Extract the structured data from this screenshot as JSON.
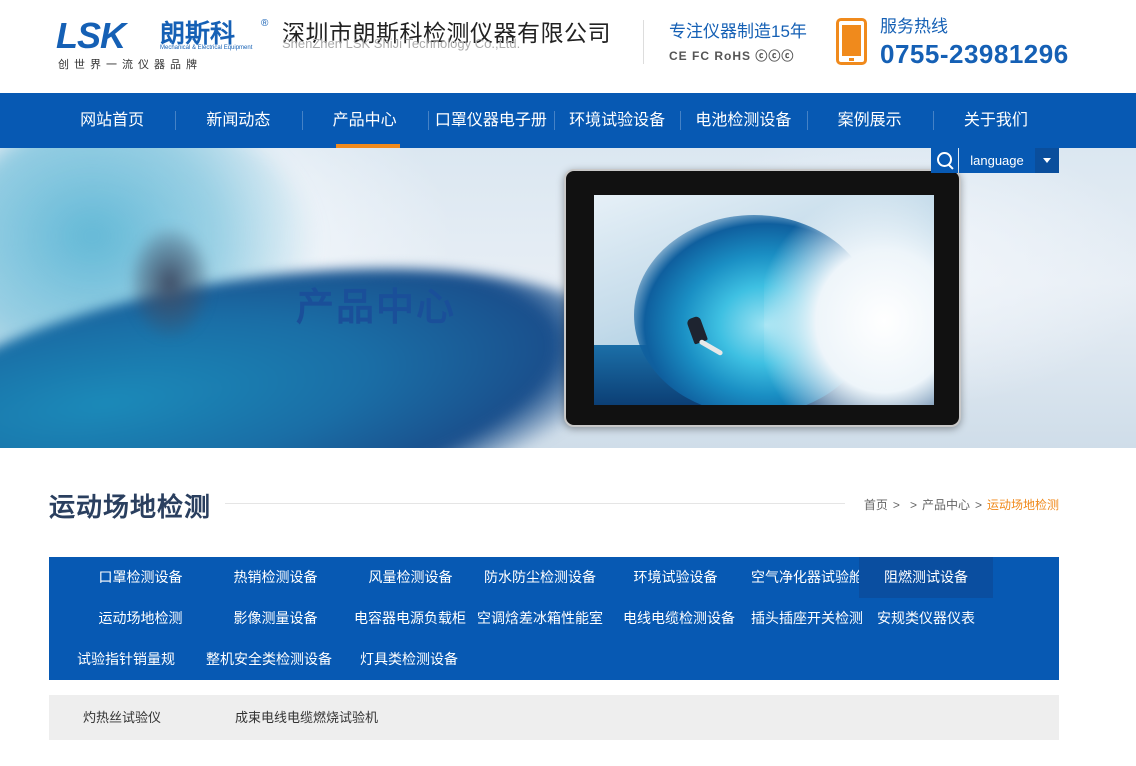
{
  "header": {
    "logo_mark": "LSK",
    "logo_cn": "朗斯科",
    "logo_reg": "®",
    "logo_en": "Mechanical & Electrical Equipment",
    "logo_slogan": "创世界一流仪器品牌",
    "company_name": "深圳市朗斯科检测仪器有限公司",
    "company_en": "ShenZhen LSK ShiJi Technology Co.,Ltd.",
    "focus_text": "专注仪器制造15年",
    "certs": "CE FC RoHS ⓒⓒⓒ",
    "hotline_label": "服务热线",
    "hotline_number": "0755-23981296"
  },
  "nav": {
    "items": [
      {
        "label": "网站首页"
      },
      {
        "label": "新闻动态"
      },
      {
        "label": "产品中心",
        "active": true
      },
      {
        "label": "口罩仪器电子册"
      },
      {
        "label": "环境试验设备"
      },
      {
        "label": "电池检测设备"
      },
      {
        "label": "案例展示"
      },
      {
        "label": "关于我们"
      }
    ]
  },
  "banner": {
    "title": "产品中心",
    "language_label": "language"
  },
  "content": {
    "section_title": "运动场地检测",
    "breadcrumb": {
      "home": "首页",
      "sep1": ">",
      "sep2": ">",
      "parent": "产品中心",
      "sep3": ">",
      "current": "运动场地检测"
    },
    "categories": [
      "口罩检测设备",
      "热销检测设备",
      "风量检测设备",
      "防水防尘检测设备",
      "环境试验设备",
      "空气净化器试验舱",
      "阻燃测试设备",
      "运动场地检测",
      "影像测量设备",
      "电容器电源负载柜",
      "空调焓差冰箱性能室",
      "电线电缆检测设备",
      "插头插座开关检测",
      "安规类仪器仪表",
      "试验指针销量规",
      "整机安全类检测设备",
      "灯具类检测设备"
    ],
    "active_category": "阻燃测试设备",
    "sub_items": [
      "灼热丝试验仪",
      "成束电线电缆燃烧试验机"
    ]
  },
  "colors": {
    "primary_blue": "#0759b3",
    "accent_orange": "#f08a1c",
    "title_text": "#2a3f5f"
  }
}
